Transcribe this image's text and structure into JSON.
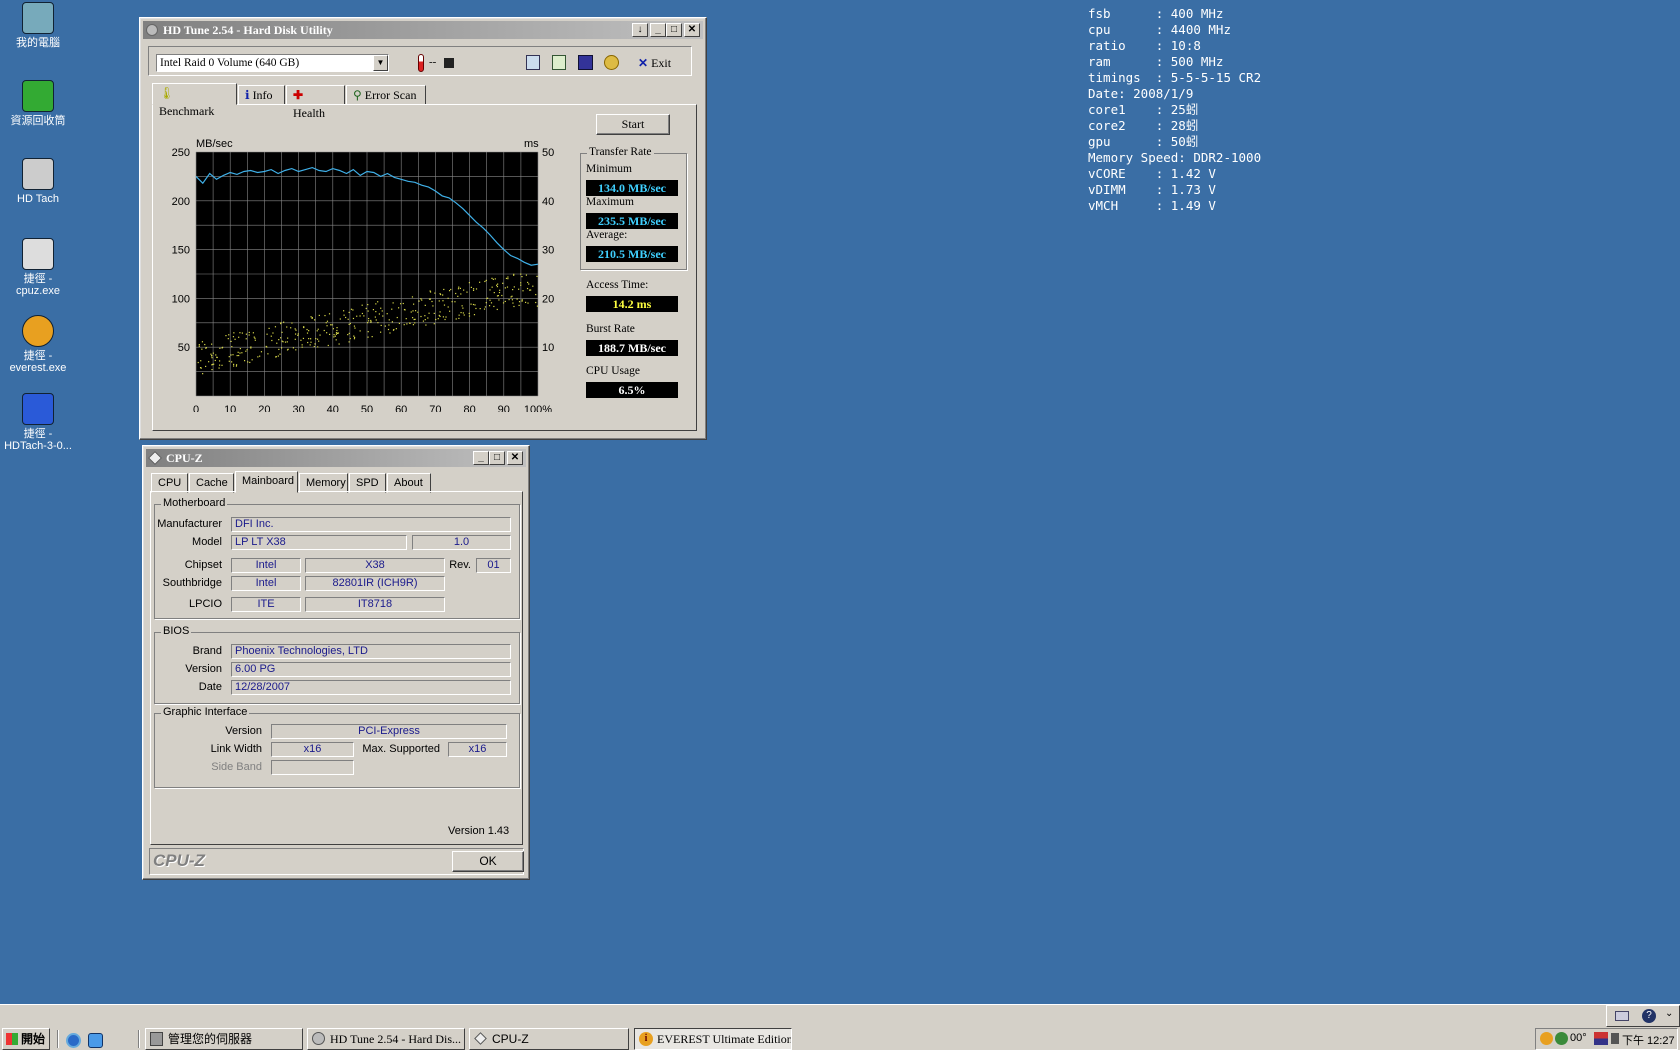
{
  "desktop": {
    "icons": [
      {
        "label": "我的電腦",
        "icon": "my-computer-icon"
      },
      {
        "label": "資源回收筒",
        "icon": "recycle-bin-icon"
      },
      {
        "label": "HD Tach",
        "icon": "hdtach-icon"
      },
      {
        "label": "捷徑 -\ncpuz.exe",
        "icon": "cpuz-shortcut-icon"
      },
      {
        "label": "捷徑 -\neverest.exe",
        "icon": "everest-shortcut-icon"
      },
      {
        "label": "捷徑 -\nHDTach-3-0...",
        "icon": "hdtach3-shortcut-icon"
      }
    ]
  },
  "overlay_lines": [
    "fsb      : 400 MHz",
    "cpu      : 4400 MHz",
    "ratio    : 10:8",
    "ram      : 500 MHz",
    "timings  : 5-5-5-15 CR2",
    "Date: 2008/1/9",
    "core1    : 25蚓",
    "core2    : 28蚓",
    "gpu      : 50蚓",
    "Memory Speed: DDR2-1000",
    "vCORE    : 1.42 V",
    "vDIMM    : 1.73 V",
    "vMCH     : 1.49 V"
  ],
  "hdtune": {
    "title": "HD Tune 2.54 - Hard Disk Utility",
    "drive": "Intel   Raid 0 Volume (640 GB)",
    "temp": "--",
    "exit_label": "Exit",
    "tabs": [
      "Benchmark",
      "Info",
      "Health",
      "Error Scan"
    ],
    "start_label": "Start",
    "transfer_rate_label": "Transfer Rate",
    "minimum_label": "Minimum",
    "minimum": "134.0 MB/sec",
    "maximum_label": "Maximum",
    "maximum": "235.5 MB/sec",
    "average_label": "Average:",
    "average": "210.5 MB/sec",
    "access_label": "Access Time:",
    "access": "14.2 ms",
    "burst_label": "Burst Rate",
    "burst": "188.7 MB/sec",
    "cpu_label": "CPU Usage",
    "cpu": "6.5%",
    "colors": {
      "transfer": "#3fb0e8",
      "access": "#d8d84a",
      "value_cyan": "#3fd0ff",
      "value_yellow": "#ffff40"
    }
  },
  "chart_data": {
    "type": "line",
    "title": "",
    "xlabel": "",
    "left_unit": "MB/sec",
    "right_unit": "ms",
    "x_ticks": [
      "0",
      "10",
      "20",
      "30",
      "40",
      "50",
      "60",
      "70",
      "80",
      "90",
      "100%"
    ],
    "y_ticks_left": [
      "250",
      "200",
      "150",
      "100",
      "50"
    ],
    "y_ticks_right": [
      "50",
      "40",
      "30",
      "20",
      "10"
    ],
    "xlim": [
      0,
      100
    ],
    "ylim_left": [
      0,
      250
    ],
    "ylim_right": [
      0,
      50
    ],
    "grid": true,
    "series": [
      {
        "axis": "left",
        "x": [
          0,
          2,
          4,
          6,
          8,
          10,
          12,
          14,
          16,
          18,
          20,
          22,
          24,
          26,
          28,
          30,
          32,
          34,
          36,
          38,
          40,
          42,
          44,
          46,
          48,
          50,
          52,
          54,
          56,
          58,
          60,
          62,
          64,
          66,
          68,
          70,
          72,
          74,
          76,
          78,
          80,
          82,
          84,
          86,
          88,
          90,
          92,
          94,
          96,
          98,
          100
        ],
        "y": [
          225,
          218,
          228,
          222,
          226,
          229,
          227,
          230,
          231,
          229,
          230,
          232,
          228,
          231,
          233,
          230,
          232,
          234,
          231,
          230,
          233,
          231,
          228,
          232,
          226,
          230,
          229,
          225,
          228,
          224,
          222,
          220,
          219,
          216,
          214,
          210,
          205,
          203,
          198,
          192,
          185,
          178,
          172,
          165,
          157,
          150,
          144,
          141,
          137,
          134,
          135
        ]
      },
      {
        "axis": "right",
        "type": "scatter",
        "x": [
          0,
          10,
          20,
          30,
          40,
          50,
          60,
          70,
          80,
          90,
          100
        ],
        "y": [
          7.5,
          9.5,
          11,
          12.5,
          14,
          15.5,
          17,
          18.5,
          20,
          21.5,
          22
        ]
      }
    ]
  },
  "cpuz": {
    "title": "CPU-Z",
    "tabs": [
      "CPU",
      "Cache",
      "Mainboard",
      "Memory",
      "SPD",
      "About"
    ],
    "motherboard_label": "Motherboard",
    "manufacturer_label": "Manufacturer",
    "manufacturer": "DFI Inc.",
    "model_label": "Model",
    "model": "LP LT X38",
    "model_rev": "1.0",
    "chipset_label": "Chipset",
    "chipset_vendor": "Intel",
    "chipset_model": "X38",
    "rev_label": "Rev.",
    "rev": "01",
    "southbridge_label": "Southbridge",
    "southbridge_vendor": "Intel",
    "southbridge_model": "82801IR (ICH9R)",
    "lpcio_label": "LPCIO",
    "lpcio_vendor": "ITE",
    "lpcio_model": "IT8718",
    "bios_label": "BIOS",
    "brand_label": "Brand",
    "brand": "Phoenix Technologies, LTD",
    "version_label": "Version",
    "bios_version": "6.00 PG",
    "date_label": "Date",
    "bios_date": "12/28/2007",
    "graphic_label": "Graphic Interface",
    "gi_version_label": "Version",
    "gi_version": "PCI-Express",
    "link_width_label": "Link Width",
    "link_width": "x16",
    "max_supported_label": "Max. Supported",
    "max_supported": "x16",
    "side_band_label": "Side Band",
    "app_version": "Version 1.43",
    "logo": "CPU-Z",
    "ok_label": "OK"
  },
  "taskbar": {
    "start_label": "開始",
    "buttons": [
      {
        "label": "管理您的伺服器"
      },
      {
        "label": "HD Tune 2.54 - Hard Dis..."
      },
      {
        "label": "CPU-Z"
      },
      {
        "label": "EVEREST Ultimate Edition"
      }
    ],
    "tray_temp": "00°",
    "clock": "下午 12:27"
  }
}
